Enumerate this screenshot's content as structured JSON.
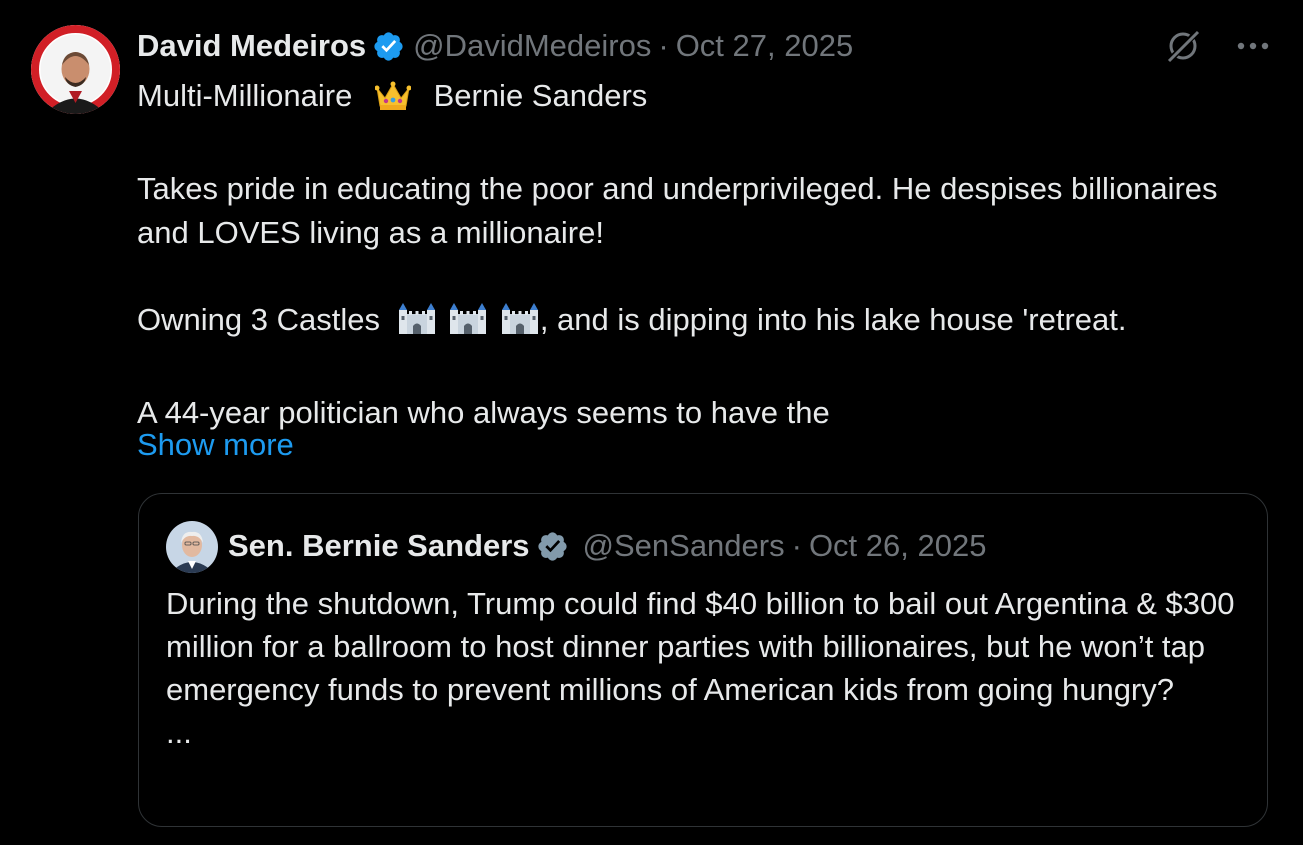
{
  "tweet": {
    "author": {
      "name": "David Medeiros",
      "handle": "@DavidMedeiros",
      "verified": true
    },
    "date": "Oct 27, 2025",
    "separator": "·",
    "lines": {
      "line1_a": "Multi-Millionaire",
      "line1_b": "Bernie Sanders",
      "para2": "Takes pride in educating the poor and underprivileged. He despises billionaires and LOVES living as a millionaire!",
      "para3_a": "Owning 3 Castles",
      "para3_b": ", and is dipping into his lake house 'retreat.",
      "para4": "A 44-year politician who always seems to have the"
    },
    "emojis": {
      "crown": "crown-icon",
      "castle": "castle-icon",
      "castle_count": 3
    },
    "show_more_label": "Show more"
  },
  "quote": {
    "author": {
      "name": "Sen. Bernie Sanders",
      "handle": "@SenSanders",
      "verified": true
    },
    "date": "Oct 26, 2025",
    "separator": "·",
    "text": "During the shutdown, Trump could find $40 billion to bail out Argentina & $300 million for a ballroom to host dinner parties with billionaires, but he won’t tap emergency funds to prevent millions of American kids from going hungry?",
    "ellipsis": "..."
  },
  "icons": {
    "grok": "grok-icon",
    "more": "more-icon",
    "verified": "verified-badge-icon"
  },
  "colors": {
    "background": "#000000",
    "text_primary": "#e7e9ea",
    "text_secondary": "#71767b",
    "link": "#1d9bf0",
    "verified": "#1d9bf0",
    "quote_verified": "#829aab",
    "border": "#2f3336"
  }
}
